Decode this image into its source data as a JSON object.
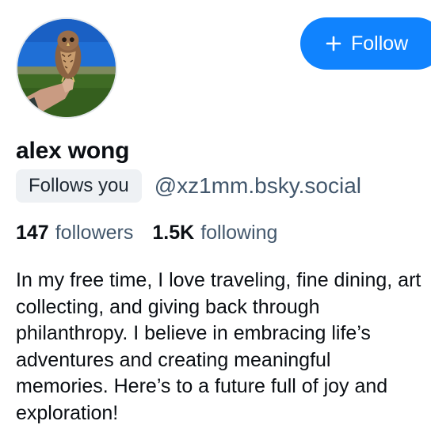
{
  "profile": {
    "display_name": "alex wong",
    "follows_you": "Follows you",
    "handle": "@xz1mm.bsky.social",
    "avatar_icon": "owl-photo-avatar",
    "followers_count": "147",
    "followers_label": "followers",
    "following_count": "1.5K",
    "following_label": "following",
    "bio": "In my free time, I love traveling, fine dining, art collecting, and giving back through philanthropy. I believe in embracing life’s adventures and creating meaningful memories. Here’s to a future full of joy and exploration!"
  },
  "actions": {
    "follow_label": "Follow",
    "follow_icon": "plus-icon"
  },
  "colors": {
    "accent": "#1083fe",
    "muted_text": "#42576c",
    "badge_bg": "#eef1f4"
  }
}
